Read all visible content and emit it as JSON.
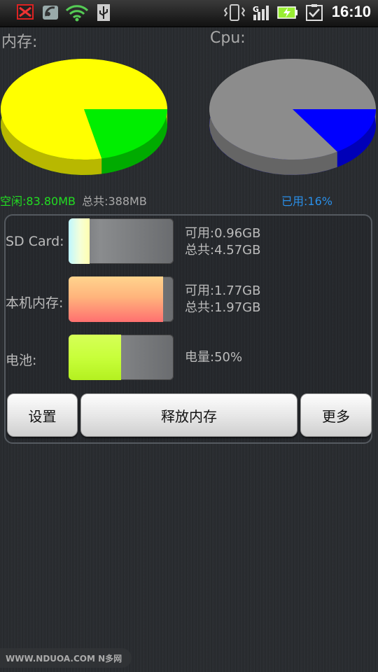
{
  "status_bar": {
    "time": "16:10",
    "icons": [
      "missed-call-icon",
      "satellite-icon",
      "wifi-icon",
      "usb-icon",
      "vibrate-icon",
      "signal-g-icon",
      "battery-charging-icon",
      "checkbox-icon"
    ]
  },
  "memory": {
    "label": "内存:",
    "free_text": "空闲:83.80MB",
    "total_text": "总共:388MB",
    "free_fraction": 0.216,
    "colors": {
      "used": "#ffff00",
      "free": "#00ee00"
    }
  },
  "cpu": {
    "label": "Cpu:",
    "used_text": "已用:16%",
    "used_fraction": 0.16,
    "colors": {
      "idle": "#8c8c8c",
      "used": "#0000ff"
    }
  },
  "storage": {
    "sd_card": {
      "label": "SD Card:",
      "available": "可用:0.96GB",
      "total": "总共:4.57GB",
      "fill_fraction": 0.2
    },
    "internal": {
      "label": "本机内存:",
      "available": "可用:1.77GB",
      "total": "总共:1.97GB",
      "fill_fraction": 0.9
    },
    "battery": {
      "label": "电池:",
      "level": "电量:50%",
      "fill_fraction": 0.5
    }
  },
  "buttons": {
    "settings": "设置",
    "release_memory": "释放内存",
    "more": "更多"
  },
  "watermark": "WWW.NDUOA.COM N多网"
}
